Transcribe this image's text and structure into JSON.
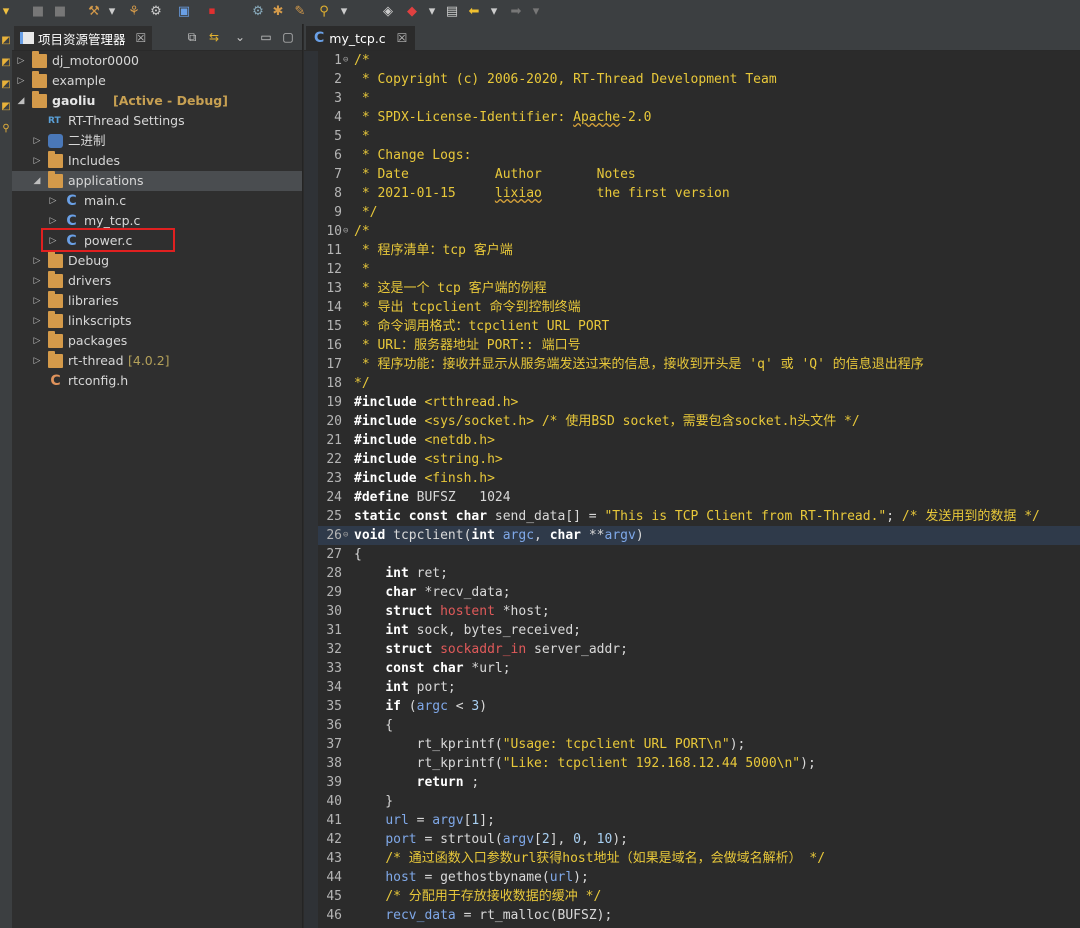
{
  "explorer": {
    "title": "项目资源管理器",
    "close": "☒",
    "items": [
      {
        "label": "dj_motor0000",
        "type": "project",
        "open": false,
        "depth": 0
      },
      {
        "label": "example",
        "type": "project",
        "open": false,
        "depth": 0
      },
      {
        "label": "gaoliu",
        "type": "project",
        "open": true,
        "depth": 0,
        "decoration": "[Active - Debug]"
      },
      {
        "label": "RT-Thread Settings",
        "type": "settings",
        "depth": 1
      },
      {
        "label": "二进制",
        "type": "binary",
        "open": false,
        "depth": 1
      },
      {
        "label": "Includes",
        "type": "includes",
        "open": false,
        "depth": 1
      },
      {
        "label": "applications",
        "type": "folder",
        "open": true,
        "depth": 1,
        "selected": true
      },
      {
        "label": "main.c",
        "type": "cfile",
        "open": false,
        "depth": 2
      },
      {
        "label": "my_tcp.c",
        "type": "cfile",
        "open": false,
        "depth": 2,
        "highlighted": true
      },
      {
        "label": "power.c",
        "type": "cfile",
        "open": false,
        "depth": 2
      },
      {
        "label": "Debug",
        "type": "folder",
        "open": false,
        "depth": 1
      },
      {
        "label": "drivers",
        "type": "folder",
        "open": false,
        "depth": 1
      },
      {
        "label": "libraries",
        "type": "folder",
        "open": false,
        "depth": 1
      },
      {
        "label": "linkscripts",
        "type": "folder",
        "open": false,
        "depth": 1
      },
      {
        "label": "packages",
        "type": "folder",
        "open": false,
        "depth": 1
      },
      {
        "label": "rt-thread",
        "type": "folder",
        "open": false,
        "depth": 1,
        "decoration": "[4.0.2]"
      },
      {
        "label": "rtconfig.h",
        "type": "hfile",
        "depth": 1
      }
    ]
  },
  "editor": {
    "tab_label": "my_tcp.c",
    "tab_close": "☒",
    "current_line": 26,
    "lines": [
      [
        [
          "cm",
          "/*"
        ]
      ],
      [
        [
          "cm",
          " * Copyright (c) 2006-2020, RT-Thread Development Team"
        ]
      ],
      [
        [
          "cm",
          " *"
        ]
      ],
      [
        [
          "cm",
          " * SPDX-License-Identifier: "
        ],
        [
          "cm sq",
          "Apache"
        ],
        [
          "cm",
          "-2.0"
        ]
      ],
      [
        [
          "cm",
          " *"
        ]
      ],
      [
        [
          "cm",
          " * Change Logs:"
        ]
      ],
      [
        [
          "cm",
          " * Date           Author       Notes"
        ]
      ],
      [
        [
          "cm",
          " * 2021-01-15     "
        ],
        [
          "cm sq",
          "lixiao"
        ],
        [
          "cm",
          "       the first version"
        ]
      ],
      [
        [
          "cm",
          " */"
        ]
      ],
      [
        [
          "cm",
          "/*"
        ]
      ],
      [
        [
          "cm",
          " * 程序清单：tcp 客户端"
        ]
      ],
      [
        [
          "cm",
          " *"
        ]
      ],
      [
        [
          "cm",
          " * 这是一个 tcp 客户端的例程"
        ]
      ],
      [
        [
          "cm",
          " * 导出 tcpclient 命令到控制终端"
        ]
      ],
      [
        [
          "cm",
          " * 命令调用格式：tcpclient URL PORT"
        ]
      ],
      [
        [
          "cm",
          " * URL：服务器地址 PORT:: 端口号"
        ]
      ],
      [
        [
          "cm",
          " * 程序功能：接收并显示从服务端发送过来的信息，接收到开头是 'q' 或 'Q' 的信息退出程序"
        ]
      ],
      [
        [
          "cm",
          "*/"
        ]
      ],
      [
        [
          "pp",
          "#include "
        ],
        [
          "inc",
          "<rtthread.h>"
        ]
      ],
      [
        [
          "pp",
          "#include "
        ],
        [
          "inc",
          "<sys/socket.h>"
        ],
        [
          "",
          ""
        ],
        [
          "cm",
          " /* 使用BSD socket，需要包含socket.h头文件 */"
        ]
      ],
      [
        [
          "pp",
          "#include "
        ],
        [
          "inc",
          "<netdb.h>"
        ]
      ],
      [
        [
          "pp",
          "#include "
        ],
        [
          "inc",
          "<string.h>"
        ]
      ],
      [
        [
          "pp",
          "#include "
        ],
        [
          "inc",
          "<finsh.h>"
        ]
      ],
      [
        [
          "pp",
          "#define "
        ],
        [
          "",
          "BUFSZ   1024"
        ]
      ],
      [
        [
          "kw",
          "static const char "
        ],
        [
          "",
          "send_data[] = "
        ],
        [
          "str",
          "\"This is TCP Client from RT-Thread.\""
        ],
        [
          "",
          "; "
        ],
        [
          "cm",
          "/* 发送用到的数据 */"
        ]
      ],
      [
        [
          "kw",
          "void "
        ],
        [
          "",
          "tcpclient("
        ],
        [
          "kw",
          "int "
        ],
        [
          "var",
          "argc"
        ],
        [
          "",
          ", "
        ],
        [
          "kw",
          "char "
        ],
        [
          "",
          "**"
        ],
        [
          "var",
          "argv"
        ],
        [
          "",
          ")"
        ]
      ],
      [
        [
          "",
          "{"
        ]
      ],
      [
        [
          "",
          "    "
        ],
        [
          "kw",
          "int "
        ],
        [
          "",
          "ret;"
        ]
      ],
      [
        [
          "",
          "    "
        ],
        [
          "kw",
          "char "
        ],
        [
          "",
          "*recv_data;"
        ]
      ],
      [
        [
          "",
          "    "
        ],
        [
          "kw",
          "struct "
        ],
        [
          "typ",
          "hostent "
        ],
        [
          "",
          "*host;"
        ]
      ],
      [
        [
          "",
          "    "
        ],
        [
          "kw",
          "int "
        ],
        [
          "",
          "sock, bytes_received;"
        ]
      ],
      [
        [
          "",
          "    "
        ],
        [
          "kw",
          "struct "
        ],
        [
          "typ",
          "sockaddr_in "
        ],
        [
          "",
          "server_addr;"
        ]
      ],
      [
        [
          "",
          "    "
        ],
        [
          "kw",
          "const char "
        ],
        [
          "",
          "*url;"
        ]
      ],
      [
        [
          "",
          "    "
        ],
        [
          "kw",
          "int "
        ],
        [
          "",
          "port;"
        ]
      ],
      [
        [
          "",
          "    "
        ],
        [
          "kw",
          "if "
        ],
        [
          "",
          "("
        ],
        [
          "var",
          "argc"
        ],
        [
          "",
          " < "
        ],
        [
          "num",
          "3"
        ],
        [
          "",
          ")"
        ]
      ],
      [
        [
          "",
          "    {"
        ]
      ],
      [
        [
          "",
          "        rt_kprintf("
        ],
        [
          "str",
          "\"Usage: tcpclient URL PORT\\n\""
        ],
        [
          "",
          ");"
        ]
      ],
      [
        [
          "",
          "        rt_kprintf("
        ],
        [
          "str",
          "\"Like: tcpclient 192.168.12.44 5000\\n\""
        ],
        [
          "",
          ");"
        ]
      ],
      [
        [
          "",
          "        "
        ],
        [
          "kw",
          "return "
        ],
        [
          "",
          ";"
        ]
      ],
      [
        [
          "",
          "    }"
        ]
      ],
      [
        [
          "",
          "    "
        ],
        [
          "var",
          "url"
        ],
        [
          "",
          " = "
        ],
        [
          "var",
          "argv"
        ],
        [
          "",
          "["
        ],
        [
          "num",
          "1"
        ],
        [
          "",
          "];"
        ]
      ],
      [
        [
          "",
          "    "
        ],
        [
          "var",
          "port"
        ],
        [
          "",
          " = strtoul("
        ],
        [
          "var",
          "argv"
        ],
        [
          "",
          "["
        ],
        [
          "num",
          "2"
        ],
        [
          "",
          "], "
        ],
        [
          "num",
          "0"
        ],
        [
          "",
          ", "
        ],
        [
          "num",
          "10"
        ],
        [
          "",
          ");"
        ]
      ],
      [
        [
          "",
          "    "
        ],
        [
          "cm",
          "/* 通过函数入口参数url获得host地址（如果是域名，会做域名解析） */"
        ]
      ],
      [
        [
          "",
          "    "
        ],
        [
          "var",
          "host"
        ],
        [
          "",
          " = gethostbyname("
        ],
        [
          "var",
          "url"
        ],
        [
          "",
          ");"
        ]
      ],
      [
        [
          "",
          "    "
        ],
        [
          "cm",
          "/* 分配用于存放接收数据的缓冲 */"
        ]
      ],
      [
        [
          "",
          "    "
        ],
        [
          "var",
          "recv_data"
        ],
        [
          "",
          " = rt_malloc(BUFSZ);"
        ]
      ]
    ]
  }
}
